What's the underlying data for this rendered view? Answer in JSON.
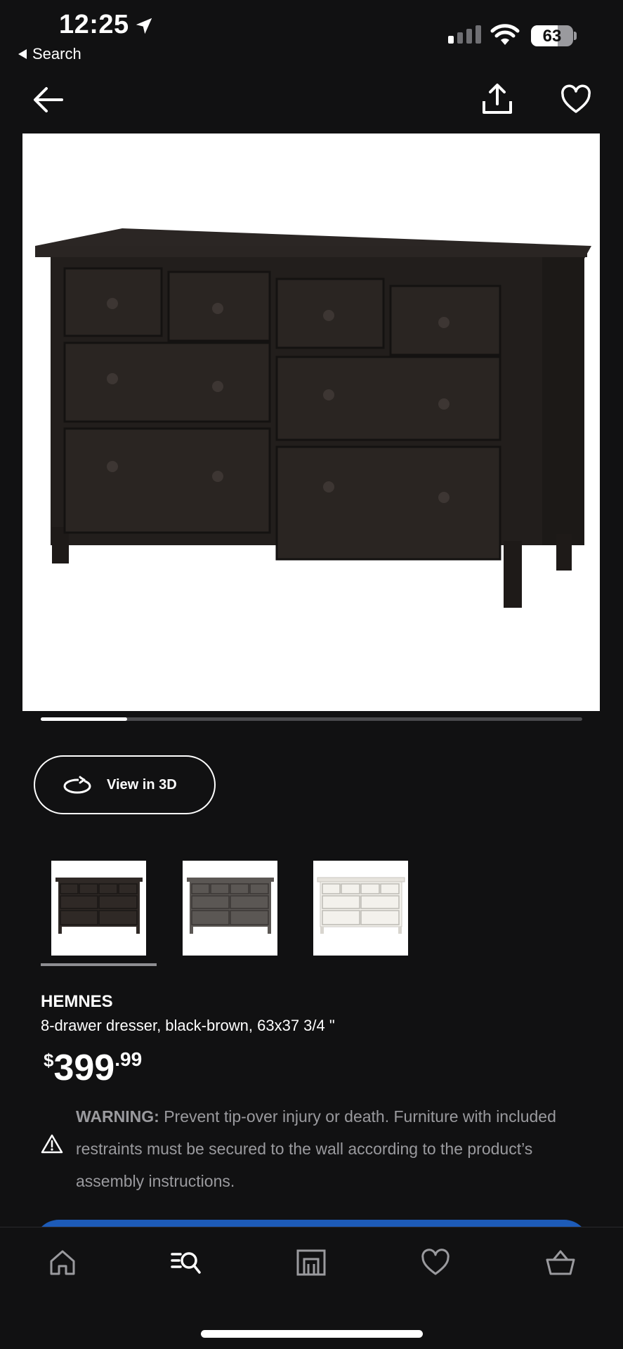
{
  "status_bar": {
    "time": "12:25",
    "back_app_label": "Search",
    "battery_percent": "63",
    "battery_level": 0.63,
    "signal_bars_on": 1
  },
  "header": {
    "back_icon": "arrow-left-icon",
    "share_icon": "share-icon",
    "favorite_icon": "heart-icon"
  },
  "gallery": {
    "image_index": 1,
    "progress": 0.16
  },
  "view3d": {
    "label": "View in 3D",
    "icon": "rotate-3d-icon"
  },
  "variants": [
    {
      "color": "#2f2926",
      "selected": true
    },
    {
      "color": "#5b5754",
      "selected": false
    },
    {
      "color": "#f3f1ec",
      "selected": false
    }
  ],
  "product": {
    "name": "HEMNES",
    "description": "8-drawer dresser, black-brown, 63x37 3/4 \"",
    "price": {
      "currency": "$",
      "main": "399",
      "decimal": ".99"
    }
  },
  "warning": {
    "label": "WARNING:",
    "text": " Prevent tip-over injury or death. Furniture with included restraints must be secured to the wall according to the product’s assembly instructions."
  },
  "colors": {
    "background": "#111112",
    "cta_blue": "#1d5bb8",
    "muted_text": "#9a9a9e"
  },
  "tabbar": {
    "items": [
      {
        "icon": "home-icon"
      },
      {
        "icon": "search-list-icon",
        "active": true
      },
      {
        "icon": "store-icon"
      },
      {
        "icon": "heart-icon"
      },
      {
        "icon": "basket-icon"
      }
    ]
  }
}
